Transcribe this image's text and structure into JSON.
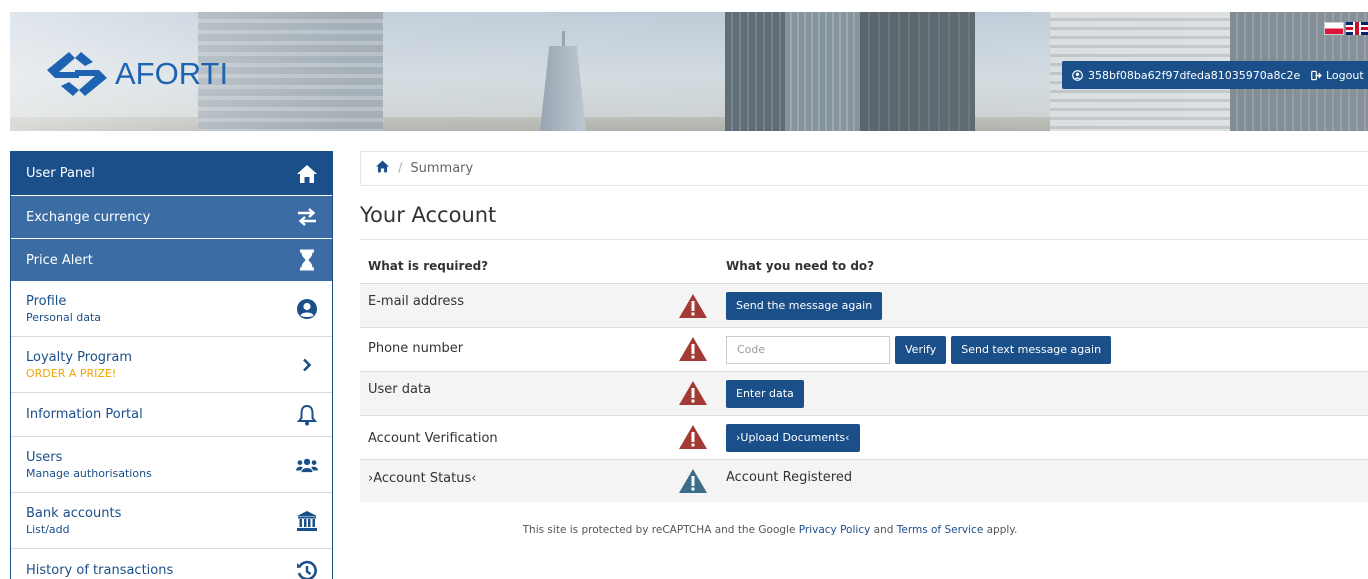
{
  "header": {
    "logo_text": "AFORTI",
    "user_id": "358bf08ba62f97dfeda81035970a8c2e",
    "logout_label": "Logout",
    "languages": [
      "pl",
      "en"
    ],
    "brand_color": "#1d63b1"
  },
  "sidebar": {
    "items": [
      {
        "label": "User Panel",
        "sub": "",
        "icon": "home-icon"
      },
      {
        "label": "Exchange currency",
        "sub": "",
        "icon": "exchange-arrows-icon"
      },
      {
        "label": "Price Alert",
        "sub": "",
        "icon": "hourglass-icon"
      },
      {
        "label": "Profile",
        "sub": "Personal data",
        "icon": "user-circle-icon"
      },
      {
        "label": "Loyalty Program",
        "sub": "ORDER A PRIZE!",
        "icon": "chevron-right-icon"
      },
      {
        "label": "Information Portal",
        "sub": "",
        "icon": "bell-icon"
      },
      {
        "label": "Users",
        "sub": "Manage authorisations",
        "icon": "users-icon"
      },
      {
        "label": "Bank accounts",
        "sub": "List/add",
        "icon": "bank-icon"
      },
      {
        "label": "History of transactions",
        "sub": "",
        "icon": "history-icon"
      }
    ],
    "active_color": "#1b4f8a",
    "secondary_color": "#3b6ca4",
    "promo_color": "#f0a500"
  },
  "breadcrumb": {
    "current": "Summary"
  },
  "main": {
    "title": "Your Account",
    "table": {
      "col_required": "What is required?",
      "col_todo": "What you need to do?",
      "rows": [
        {
          "required": "E-mail address",
          "status": "warning",
          "button": "Send the message again"
        },
        {
          "required": "Phone number",
          "status": "warning",
          "placeholder": "Code",
          "verify": "Verify",
          "button": "Send text message again"
        },
        {
          "required": "User data",
          "status": "warning",
          "button": "Enter data"
        },
        {
          "required": "Account Verification",
          "status": "warning",
          "button": "›Upload Documents‹"
        },
        {
          "required": "›Account Status‹",
          "status": "info",
          "text": "Account Registered"
        }
      ],
      "warning_color": "#a33a35",
      "info_color": "#3e6d89"
    }
  },
  "footer": {
    "before": "This site is protected by reCAPTCHA and the Google ",
    "privacy": "Privacy Policy",
    "and": " and ",
    "terms": "Terms of Service",
    "after": " apply."
  }
}
